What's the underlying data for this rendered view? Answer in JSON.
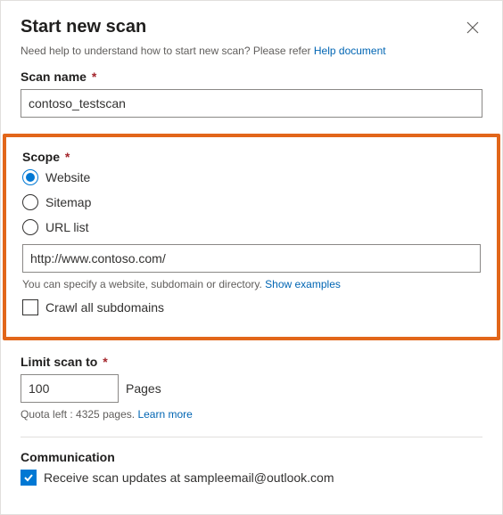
{
  "header": {
    "title": "Start new scan",
    "help_prefix": "Need help to understand how to start new scan? Please refer ",
    "help_link": "Help document"
  },
  "scan_name": {
    "label": "Scan name",
    "required_mark": "*",
    "value": "contoso_testscan"
  },
  "scope": {
    "label": "Scope",
    "required_mark": "*",
    "options": [
      {
        "label": "Website",
        "selected": true
      },
      {
        "label": "Sitemap",
        "selected": false
      },
      {
        "label": "URL list",
        "selected": false
      }
    ],
    "url_value": "http://www.contoso.com/",
    "helper_prefix": "You can specify a website, subdomain or directory. ",
    "helper_link": "Show examples",
    "crawl_label": "Crawl all subdomains",
    "crawl_checked": false
  },
  "limit": {
    "label": "Limit scan to",
    "required_mark": "*",
    "value": "100",
    "unit": "Pages",
    "quota_prefix": "Quota left : 4325 pages. ",
    "quota_link": "Learn more"
  },
  "communication": {
    "label": "Communication",
    "receive_label": "Receive scan updates at sampleemail@outlook.com",
    "receive_checked": true
  }
}
